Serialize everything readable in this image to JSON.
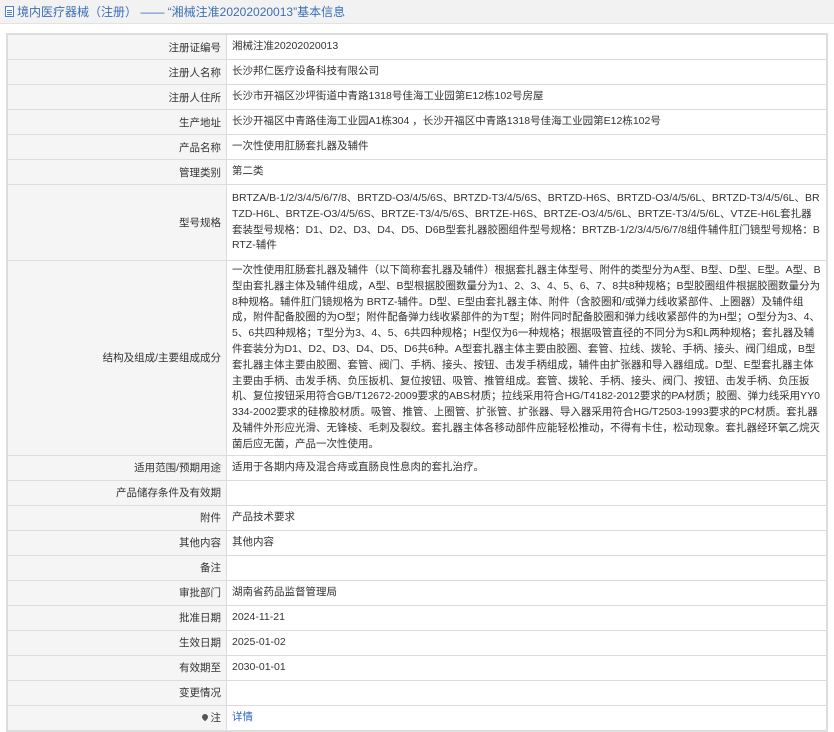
{
  "header": {
    "title": "境内医疗器械（注册） —— “湘械注准20202020013”基本信息"
  },
  "rows": [
    {
      "label": "注册证编号",
      "value": "湘械注准20202020013"
    },
    {
      "label": "注册人名称",
      "value": "长沙邦仁医疗设备科技有限公司"
    },
    {
      "label": "注册人住所",
      "value": "长沙市开福区沙坪街道中青路1318号佳海工业园第E12栋102号房屋"
    },
    {
      "label": "生产地址",
      "value": "长沙开福区中青路佳海工业园A1栋304 ，长沙开福区中青路1318号佳海工业园第E12栋102号"
    },
    {
      "label": "产品名称",
      "value": "一次性使用肛肠套扎器及辅件"
    },
    {
      "label": "管理类别",
      "value": "第二类"
    },
    {
      "label": "型号规格",
      "value": "BRTZA/B-1/2/3/4/5/6/7/8、BRTZD-O3/4/5/6S、BRTZD-T3/4/5/6S、BRTZD-H6S、BRTZD-O3/4/5/6L、BRTZD-T3/4/5/6L、BRTZD-H6L、BRTZE-O3/4/5/6S、BRTZE-T3/4/5/6S、BRTZE-H6S、BRTZE-O3/4/5/6L、BRTZE-T3/4/5/6L、VTZE-H6L套扎器套装型号规格：D1、D2、D3、D4、D5、D6B型套扎器胶圈组件型号规格：BRTZB-1/2/3/4/5/6/7/8组件辅件肛门镜型号规格：BRTZ-辅件"
    },
    {
      "label": "结构及组成/主要组成成分",
      "value": "一次性使用肛肠套扎器及辅件（以下简称套扎器及辅件）根据套扎器主体型号、附件的类型分为A型、B型、D型、E型。A型、B型由套扎器主体及辅件组成，A型、B型根据胶圈数量分为1、2、3、4、5、6、7、8共8种规格；B型胶圈组件根据胶圈数量分为8种规格。辅件肛门镜规格为 BRTZ-辅件。D型、E型由套扎器主体、附件（含胶圈和/或弹力线收紧部件、上圈器）及辅件组成，附件配备胶圈的为O型；附件配备弹力线收紧部件的为T型；附件同时配备胶圈和弹力线收紧部件的为H型；O型分为3、4、5、6共四种规格；T型分为3、4、5、6共四种规格；H型仅为6一种规格；根据吸管直径的不同分为S和L两种规格；套扎器及辅件套装分为D1、D2、D3、D4、D5、D6共6种。A型套扎器主体主要由胶圈、套管、拉线、拨轮、手柄、接头、阀门组成，B型套扎器主体主要由胶圈、套管、阀门、手柄、接头、按钮、击发手柄组成，辅件由扩张器和导入器组成。D型、E型套扎器主体主要由手柄、击发手柄、负压扳机、复位按钮、吸管、推管组成。套管、拨轮、手柄、接头、阀门、按钮、击发手柄、负压扳机、复位按钮采用符合GB/T12672-2009要求的ABS材质；拉线采用符合HG/T4182-2012要求的PA材质；胶圈、弹力线采用YY0334-2002要求的硅橡胶材质。吸管、推管、上圈管、扩张管、扩张器、导入器采用符合HG/T2503-1993要求的PC材质。套扎器及辅件外形应光滑、无锋棱、毛刺及裂纹。套扎器主体各移动部件应能轻松推动，不得有卡住，松动现象。套扎器经环氧乙烷灭菌后应无菌，产品一次性使用。"
    },
    {
      "label": "适用范围/预期用途",
      "value": "适用于各期内痔及混合痔或直肠良性息肉的套扎治疗。"
    },
    {
      "label": "产品储存条件及有效期",
      "value": ""
    },
    {
      "label": "附件",
      "value": "产品技术要求"
    },
    {
      "label": "其他内容",
      "value": "其他内容"
    },
    {
      "label": "备注",
      "value": ""
    },
    {
      "label": "审批部门",
      "value": "湖南省药品监督管理局"
    },
    {
      "label": "批准日期",
      "value": "2024-11-21"
    },
    {
      "label": "生效日期",
      "value": "2025-01-02"
    },
    {
      "label": "有效期至",
      "value": "2030-01-01"
    },
    {
      "label": "变更情况",
      "value": ""
    }
  ],
  "footer_row": {
    "label": "注",
    "link": "详情"
  }
}
